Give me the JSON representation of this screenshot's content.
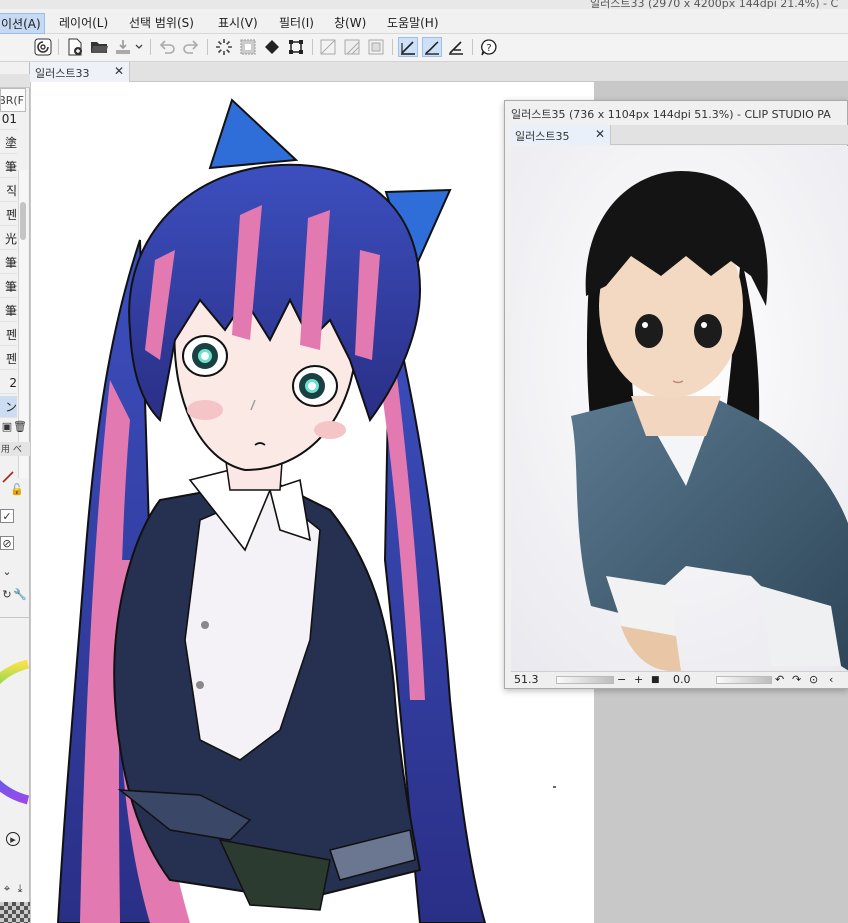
{
  "title_partial": "일러스트33 (2970 x 4200px 144dpi 21.4%) - C",
  "menu": {
    "animation": "이션(A)",
    "layer": "레이어(L)",
    "selection": "선택 범위(S)",
    "view": "표시(V)",
    "filter": "필터(I)",
    "window": "창(W)",
    "help": "도움말(H)"
  },
  "main_tab": {
    "label": "일러스트33"
  },
  "left_panel": {
    "brush_header": "BR(F",
    "brush_items": [
      "01",
      "塗",
      "筆",
      "직",
      "펜",
      "光",
      "筆",
      "筆",
      "筆",
      "펜",
      "펜",
      "2",
      "ン"
    ],
    "selected_index": 12,
    "sub_label": "用 べ"
  },
  "sub_window": {
    "title": "일러스트35 (736 x 1104px 144dpi 51.3%)  - CLIP STUDIO PA",
    "tab_label": "일러스트35",
    "zoom": "51.3",
    "rotation": "0.0"
  },
  "colors": {
    "hair_blue": "#2d3a9e",
    "hair_pink": "#e27ab1",
    "bow_blue": "#2f6ed8",
    "jacket_navy": "#263151",
    "selection_bg": "#cde0f7"
  }
}
